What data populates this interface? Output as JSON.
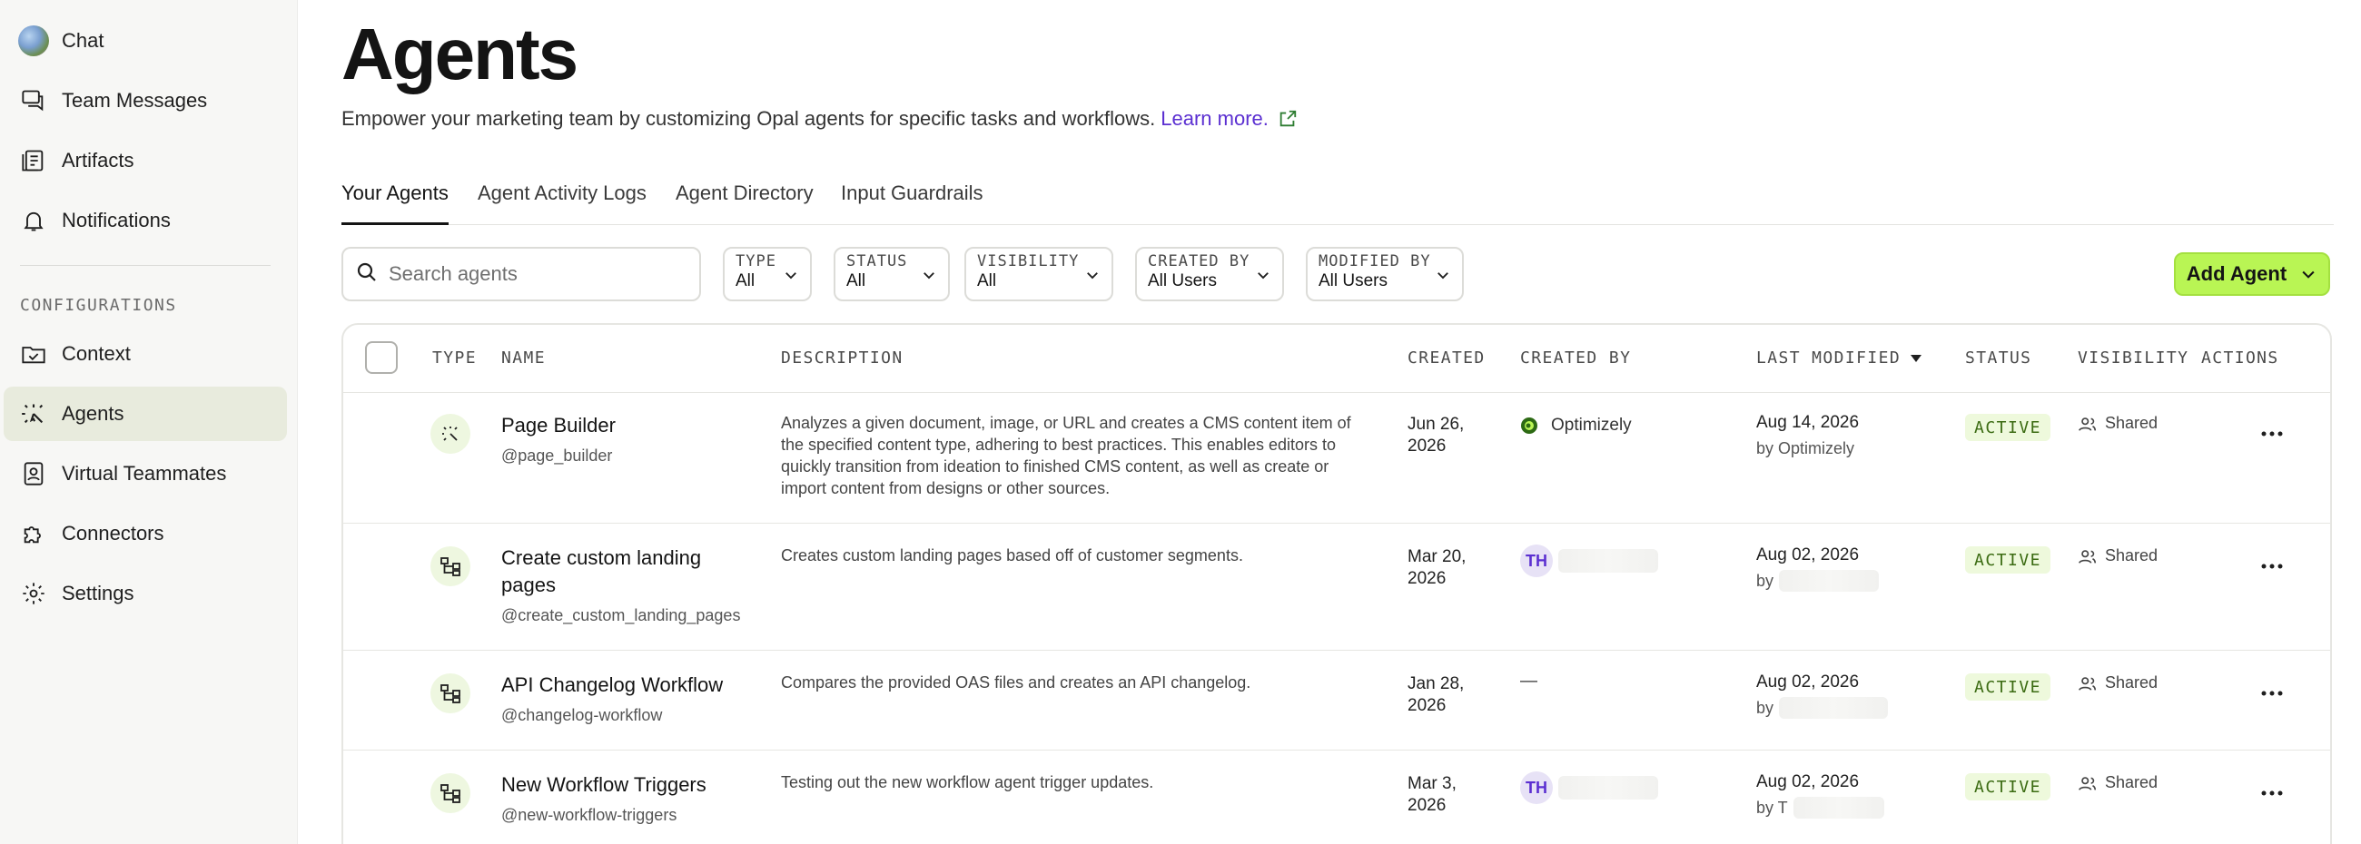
{
  "sidebar": {
    "items": [
      {
        "label": "Chat",
        "icon": "globe-avatar"
      },
      {
        "label": "Team Messages",
        "icon": "chat-bubbles-icon"
      },
      {
        "label": "Artifacts",
        "icon": "document-list-icon"
      },
      {
        "label": "Notifications",
        "icon": "bell-icon"
      }
    ],
    "section_label": "CONFIGURATIONS",
    "config_items": [
      {
        "label": "Context",
        "icon": "folder-check-icon"
      },
      {
        "label": "Agents",
        "icon": "agent-sparkle-icon",
        "active": true
      },
      {
        "label": "Virtual Teammates",
        "icon": "id-badge-icon"
      },
      {
        "label": "Connectors",
        "icon": "puzzle-icon"
      },
      {
        "label": "Settings",
        "icon": "gear-icon"
      }
    ]
  },
  "header": {
    "title": "Agents",
    "subtitle": "Empower your marketing team by customizing Opal agents for specific tasks and workflows.",
    "learn_more": "Learn more."
  },
  "tabs": [
    {
      "label": "Your Agents",
      "active": true
    },
    {
      "label": "Agent Activity Logs"
    },
    {
      "label": "Agent Directory"
    },
    {
      "label": "Input Guardrails"
    }
  ],
  "search": {
    "placeholder": "Search agents"
  },
  "filters": [
    {
      "label": "TYPE",
      "value": "All"
    },
    {
      "label": "STATUS",
      "value": "All"
    },
    {
      "label": "VISIBILITY",
      "value": "All"
    },
    {
      "label": "CREATED BY",
      "value": "All Users"
    },
    {
      "label": "MODIFIED BY",
      "value": "All Users"
    }
  ],
  "add_agent_label": "Add Agent",
  "table": {
    "columns": [
      "TYPE",
      "NAME",
      "DESCRIPTION",
      "CREATED",
      "CREATED BY",
      "LAST MODIFIED",
      "STATUS",
      "VISIBILITY",
      "ACTIONS"
    ],
    "rows": [
      {
        "type_icon": "agent-sparkle-icon",
        "name": "Page Builder",
        "handle": "@page_builder",
        "description": "Analyzes a given document, image, or URL and creates a CMS content item of the specified content type, adhering to best practices. This enables editors to quickly transition from ideation to finished CMS content, as well as create or import content from designs or other sources.",
        "created_line1": "Jun 26,",
        "created_line2": "2026",
        "created_by": "Optimizely",
        "modified_date": "Aug 14, 2026",
        "modified_by": "by Optimizely",
        "status": "ACTIVE",
        "visibility": "Shared"
      },
      {
        "type_icon": "workflow-icon",
        "name": "Create custom landing pages",
        "handle": "@create_custom_landing_pages",
        "description": "Creates custom landing pages based off of customer segments.",
        "created_line1": "Mar 20,",
        "created_line2": "2026",
        "created_by_initials": "TH",
        "modified_date": "Aug 02, 2026",
        "modified_by": "by",
        "status": "ACTIVE",
        "visibility": "Shared"
      },
      {
        "type_icon": "workflow-icon",
        "name": "API Changelog Workflow",
        "handle": "@changelog-workflow",
        "description": "Compares the provided OAS files and creates an API changelog.",
        "created_line1": "Jan 28,",
        "created_line2": "2026",
        "created_by": "—",
        "modified_date": "Aug 02, 2026",
        "modified_by": "by",
        "status": "ACTIVE",
        "visibility": "Shared"
      },
      {
        "type_icon": "workflow-icon",
        "name": "New Workflow Triggers",
        "handle": "@new-workflow-triggers",
        "description": "Testing out the new workflow agent trigger updates.",
        "created_line1": "Mar 3,",
        "created_line2": "2026",
        "created_by_initials": "TH",
        "modified_date": "Aug 02, 2026",
        "modified_by": "by T",
        "status": "ACTIVE",
        "visibility": "Shared"
      }
    ]
  },
  "colors": {
    "accent_green": "#b9f554",
    "link_purple": "#5b2fd1",
    "status_green": "#3b6b12",
    "active_nav": "#e8ebdd"
  }
}
